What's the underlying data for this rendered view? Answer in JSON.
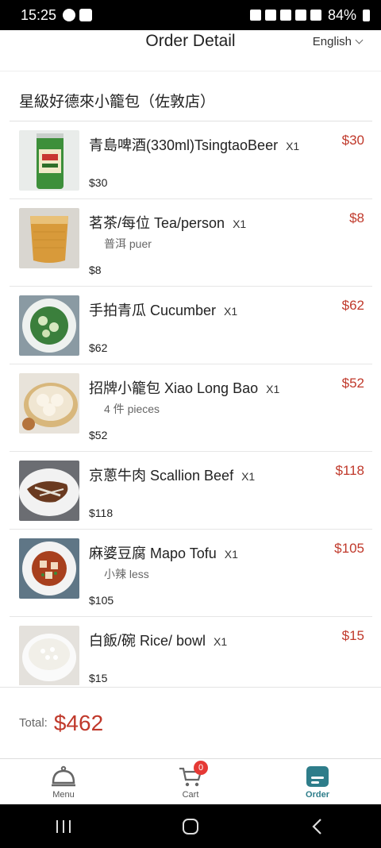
{
  "status_bar": {
    "time": "15:25",
    "battery": "84%"
  },
  "header": {
    "title": "Order Detail",
    "language": "English"
  },
  "store": {
    "name": "星級好德來小籠包（佐敦店）"
  },
  "items": [
    {
      "name": "青島啤酒(330ml)TsingtaoBeer",
      "qty": "X1",
      "total": "$30",
      "note": "",
      "unit_price": "$30",
      "thumb": "beer-can"
    },
    {
      "name": "茗茶/每位 Tea/person",
      "qty": "X1",
      "total": "$8",
      "note": "普洱 puer",
      "unit_price": "$8",
      "thumb": "tea-glass"
    },
    {
      "name": "手拍青瓜 Cucumber",
      "qty": "X1",
      "total": "$62",
      "note": "",
      "unit_price": "$62",
      "thumb": "cucumber-plate"
    },
    {
      "name": "招牌小籠包 Xiao Long Bao",
      "qty": "X1",
      "total": "$52",
      "note": "4 件 pieces",
      "unit_price": "$52",
      "thumb": "dumpling-steamer"
    },
    {
      "name": "京蔥牛肉 Scallion Beef",
      "qty": "X1",
      "total": "$118",
      "note": "",
      "unit_price": "$118",
      "thumb": "beef-plate"
    },
    {
      "name": "麻婆豆腐 Mapo Tofu",
      "qty": "X1",
      "total": "$105",
      "note": "小辣 less",
      "unit_price": "$105",
      "thumb": "tofu-plate"
    },
    {
      "name": "白飯/碗 Rice/ bowl",
      "qty": "X1",
      "total": "$15",
      "note": "",
      "unit_price": "$15",
      "thumb": "rice-bowl"
    }
  ],
  "total": {
    "label": "Total:",
    "amount": "$462"
  },
  "tabs": [
    {
      "label": "Menu",
      "icon": "cloche-icon",
      "active": false
    },
    {
      "label": "Cart",
      "icon": "cart-icon",
      "active": false,
      "badge": "0"
    },
    {
      "label": "Order",
      "icon": "order-icon",
      "active": true
    }
  ],
  "colors": {
    "price": "#c0392b",
    "accent": "#2e7d8a",
    "badge": "#e53935"
  }
}
